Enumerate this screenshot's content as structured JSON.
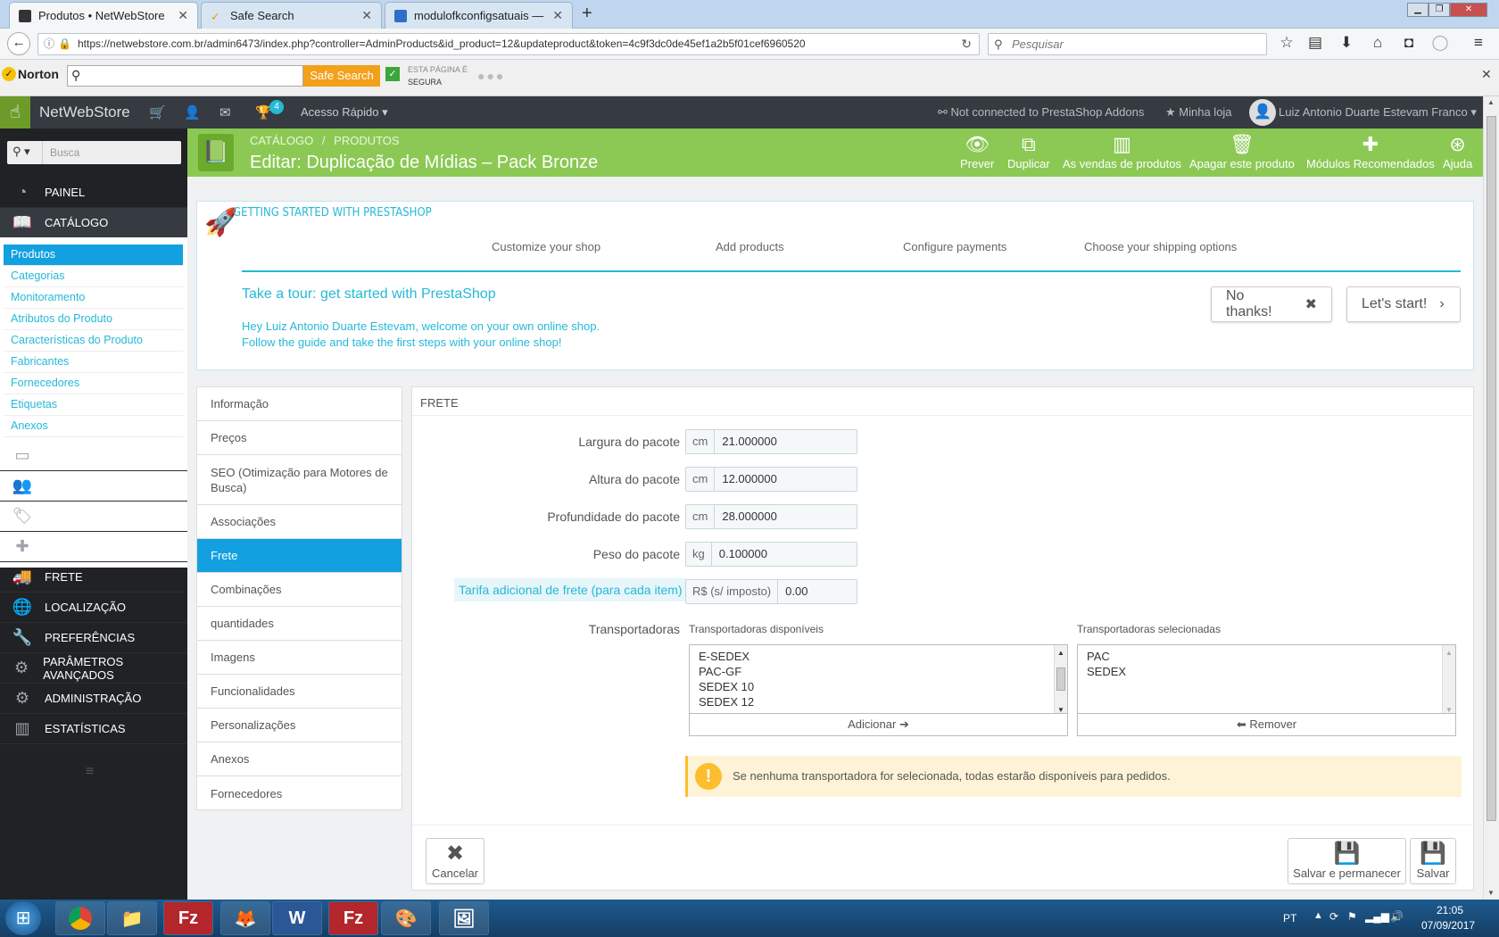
{
  "browser": {
    "tabs": [
      {
        "label": "Produtos • NetWebStore"
      },
      {
        "label": "Safe Search"
      },
      {
        "label": "modulofkconfigsatuais — im"
      }
    ],
    "url": "https://netwebstore.com.br/admin6473/index.php?controller=AdminProducts&id_product=12&updateproduct&token=4c9f3dc0de45ef1a2b5f01cef6960520",
    "search_placeholder": "Pesquisar"
  },
  "norton": {
    "brand": "Norton",
    "button": "Safe Search",
    "status_line1": "ESTA PÁGINA É",
    "status_line2": "SEGURA"
  },
  "header": {
    "shop": "NetWebStore",
    "badge": "4",
    "quick": "Acesso Rápido",
    "addons": "Not connected to PrestaShop Addons",
    "myshop": "Minha loja",
    "user": "Luiz Antonio Duarte Estevam Franco"
  },
  "sidebar": {
    "search_placeholder": "Busca",
    "top": [
      {
        "label": "PAINEL"
      },
      {
        "label": "CATÁLOGO"
      }
    ],
    "sub": [
      {
        "label": "Produtos"
      },
      {
        "label": "Categorias"
      },
      {
        "label": "Monitoramento"
      },
      {
        "label": "Atributos do Produto"
      },
      {
        "label": "Características do Produto"
      },
      {
        "label": "Fabricantes"
      },
      {
        "label": "Fornecedores"
      },
      {
        "label": "Etiquetas"
      },
      {
        "label": "Anexos"
      }
    ],
    "bottom": [
      {
        "label": "COMPRAS"
      },
      {
        "label": "CLIENTES"
      },
      {
        "label": "REGRAS DE PREÇO"
      },
      {
        "label": "MÓDULOS"
      },
      {
        "label": "FRETE"
      },
      {
        "label": "LOCALIZAÇÃO"
      },
      {
        "label": "PREFERÊNCIAS"
      },
      {
        "label": "PARÂMETROS AVANÇADOS"
      },
      {
        "label": "ADMINISTRAÇÃO"
      },
      {
        "label": "ESTATÍSTICAS"
      }
    ]
  },
  "toolbar": {
    "bc1": "CATÁLOGO",
    "bc_sep": "/",
    "bc2": "PRODUTOS",
    "title": "Editar: Duplicação de Mídias – Pack Bronze",
    "buttons": [
      {
        "label": "Prever"
      },
      {
        "label": "Duplicar"
      },
      {
        "label": "As vendas de produtos"
      },
      {
        "label": "Apagar este produto"
      },
      {
        "label": "Módulos Recomendados"
      },
      {
        "label": "Ajuda"
      }
    ]
  },
  "getting_started": {
    "title": "GETTING STARTED WITH PRESTASHOP",
    "steps": [
      {
        "label": "Customize your shop"
      },
      {
        "label": "Add products"
      },
      {
        "label": "Configure payments"
      },
      {
        "label": "Choose your shipping options"
      }
    ],
    "tour": "Take a tour: get started with PrestaShop",
    "line1": "Hey Luiz Antonio Duarte Estevam, welcome on your own online shop.",
    "line2": "Follow the guide and take the first steps with your online shop!",
    "no": "No thanks!",
    "start": "Let's start!"
  },
  "product_tabs": [
    {
      "label": "Informação"
    },
    {
      "label": "Preços"
    },
    {
      "label": "SEO (Otimização para Motores de Busca)"
    },
    {
      "label": "Associações"
    },
    {
      "label": "Frete"
    },
    {
      "label": "Combinações"
    },
    {
      "label": "quantidades"
    },
    {
      "label": "Imagens"
    },
    {
      "label": "Funcionalidades"
    },
    {
      "label": "Personalizações"
    },
    {
      "label": "Anexos"
    },
    {
      "label": "Fornecedores"
    }
  ],
  "form": {
    "title": "FRETE",
    "width": {
      "label": "Largura do pacote",
      "unit": "cm",
      "value": "21.000000"
    },
    "height": {
      "label": "Altura do pacote",
      "unit": "cm",
      "value": "12.000000"
    },
    "depth": {
      "label": "Profundidade do pacote",
      "unit": "cm",
      "value": "28.000000"
    },
    "weight": {
      "label": "Peso do pacote",
      "unit": "kg",
      "value": "0.100000"
    },
    "fee": {
      "label": "Tarifa adicional de frete (para cada item)",
      "unit": "R$ (s/ imposto)",
      "value": "0.00"
    },
    "carriers_label": "Transportadoras",
    "available_label": "Transportadoras disponíveis",
    "selected_label": "Transportadoras selecionadas",
    "available": [
      "E-SEDEX",
      "PAC-GF",
      "SEDEX 10",
      "SEDEX 12"
    ],
    "selected": [
      "PAC",
      "SEDEX"
    ],
    "add": "Adicionar",
    "remove": "Remover",
    "alert": "Se nenhuma transportadora for selecionada, todas estarão disponíveis para pedidos.",
    "cancel": "Cancelar",
    "save_stay": "Salvar e permanecer",
    "save": "Salvar"
  },
  "taskbar": {
    "lang": "PT",
    "time": "21:05",
    "date": "07/09/2017"
  },
  "colors": {
    "primary": "#25b9d7",
    "green": "#8bc954",
    "active": "#12a0e0"
  }
}
